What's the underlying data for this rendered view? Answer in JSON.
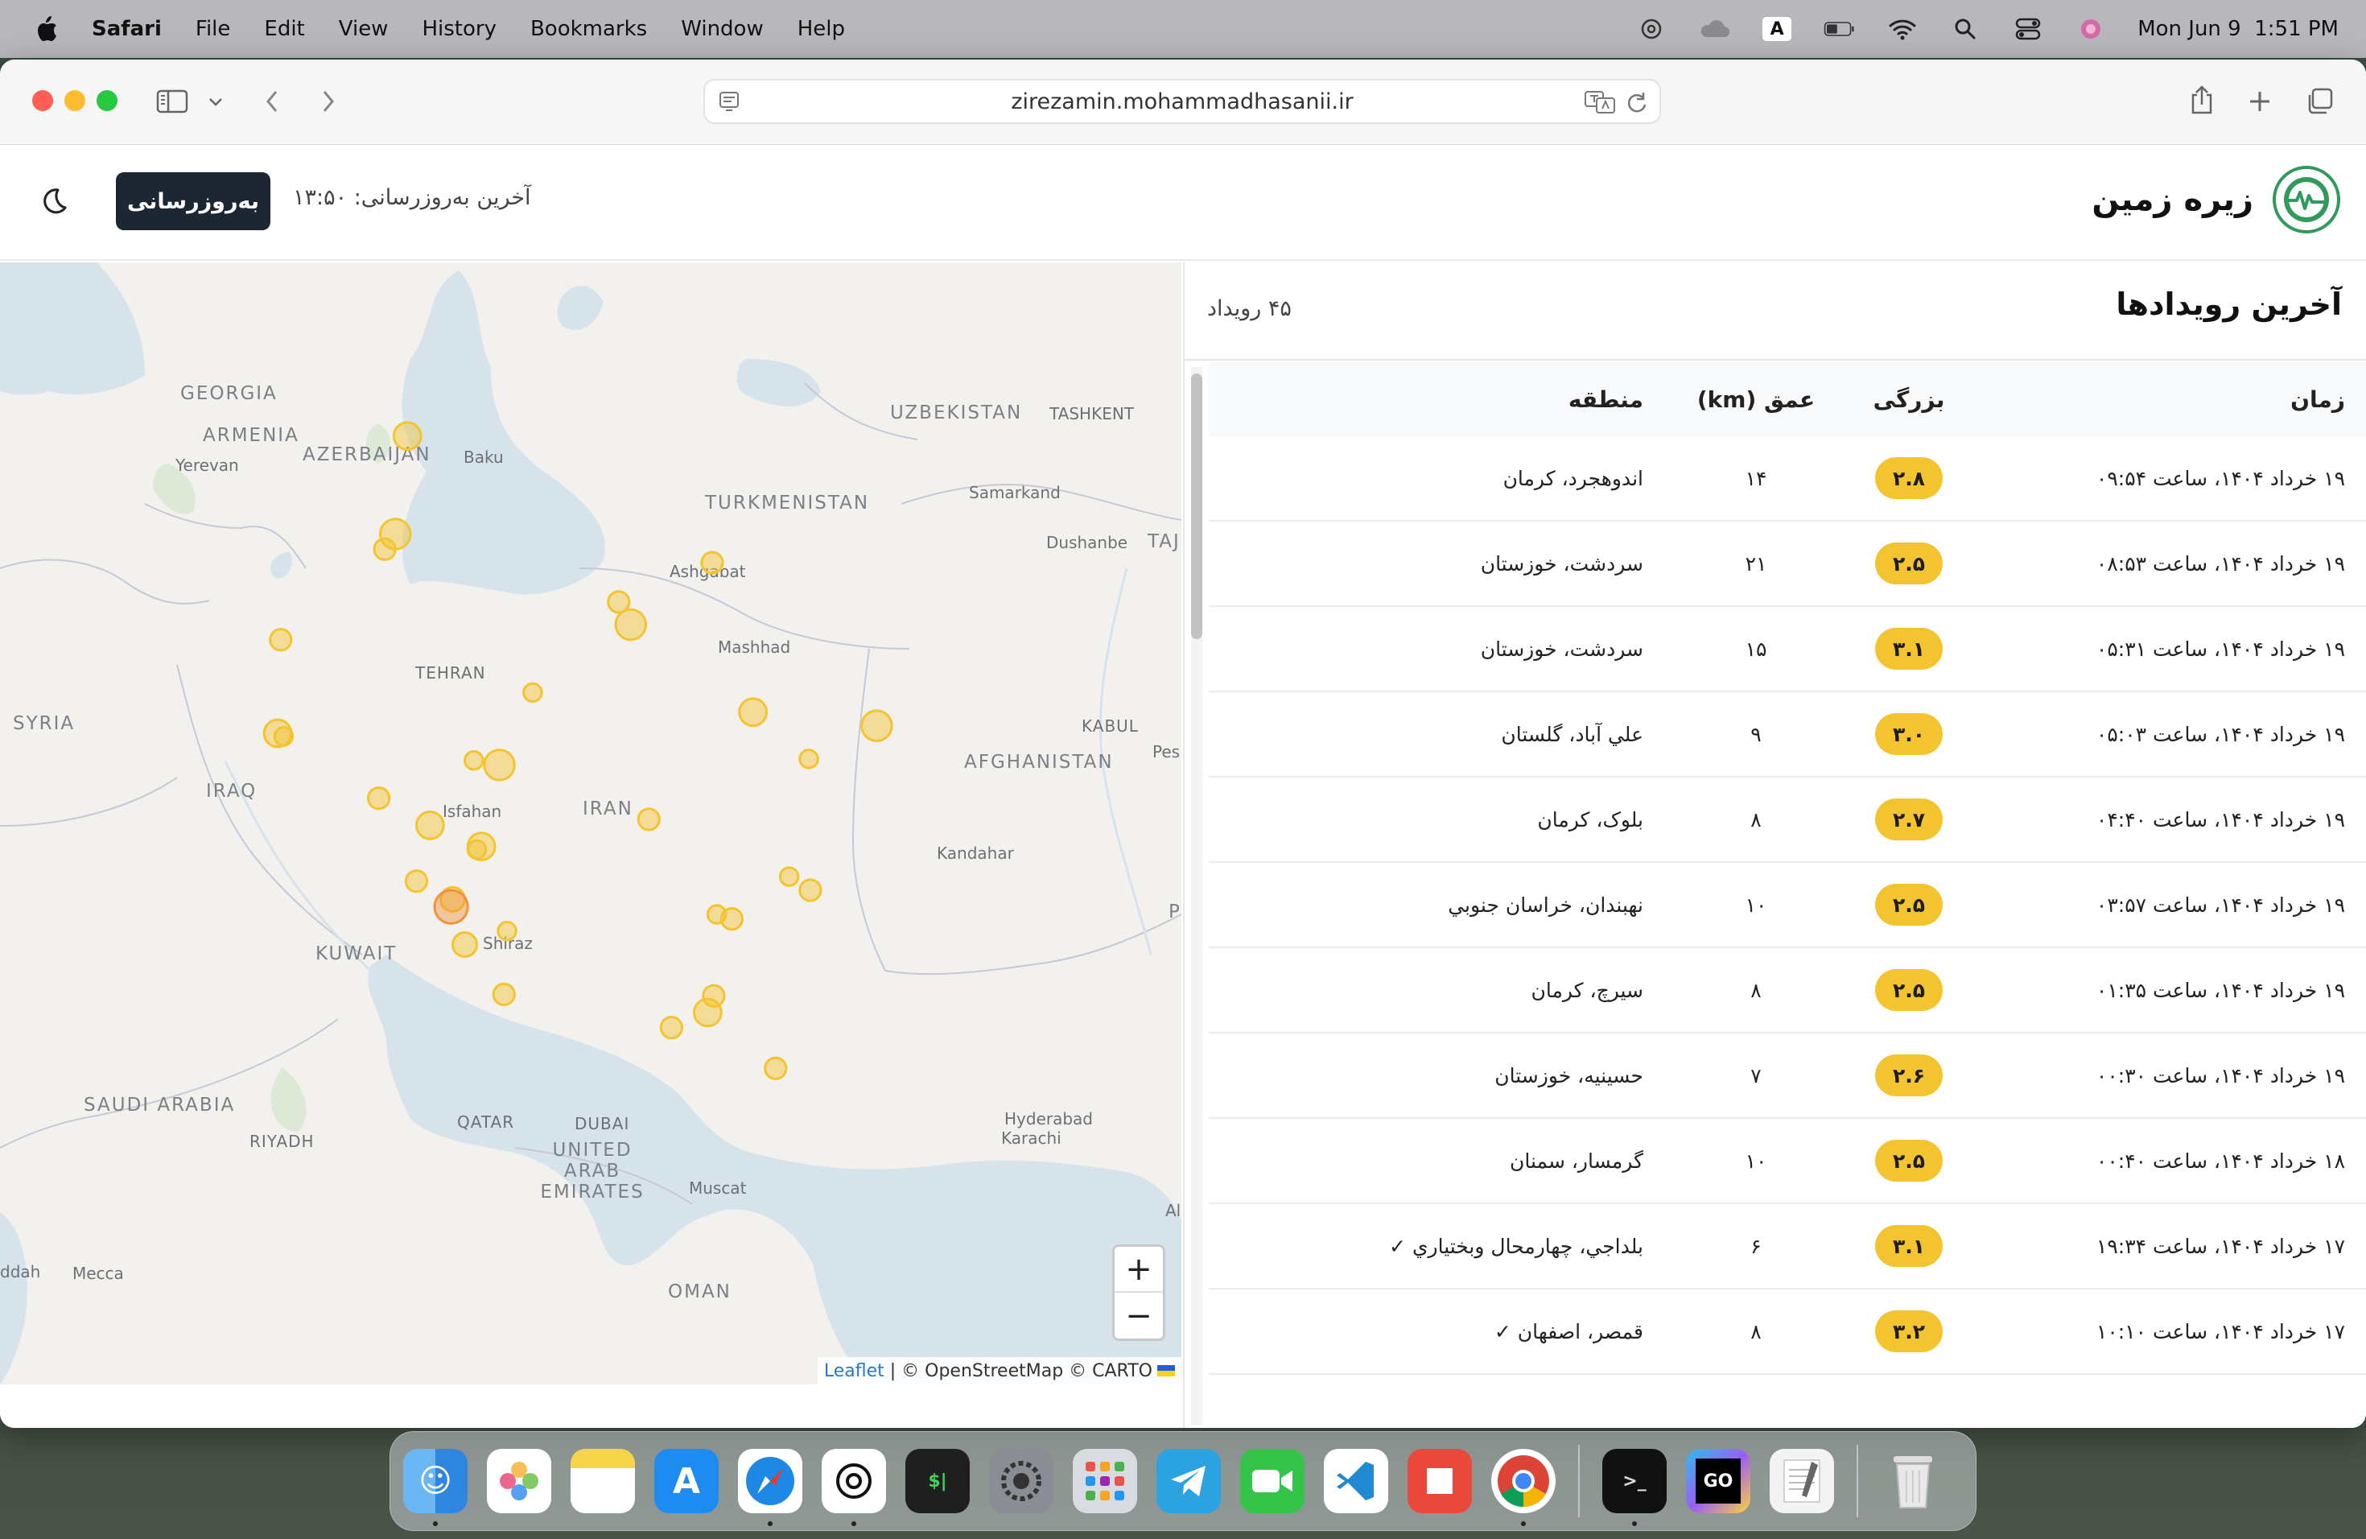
{
  "menubar": {
    "app": "Safari",
    "items": [
      "File",
      "Edit",
      "View",
      "History",
      "Bookmarks",
      "Window",
      "Help"
    ],
    "input_badge": "A",
    "datetime": "Mon Jun 9  1:51 PM"
  },
  "browser": {
    "url": "zirezamin.mohammadhasanii.ir"
  },
  "header": {
    "brand": "زیره زمین",
    "update_button": "به‌روزرسانی",
    "last_update": "آخرین به‌روزرسانی: ۱۳:۵۰"
  },
  "map": {
    "labels": {
      "georgia": "GEORGIA",
      "armenia": "ARMENIA",
      "azerbaijan": "AZERBAIJAN",
      "yerevan": "Yerevan",
      "baku": "Baku",
      "uzbekistan": "UZBEKISTAN",
      "tashkent": "TASHKENT",
      "turkmenistan": "TURKMENISTAN",
      "samarkand": "Samarkand",
      "dushanbe": "Dushanbe",
      "taj": "TAJ",
      "ashgabat": "Ashgabat",
      "syria": "SYRIA",
      "tehran": "TEHRAN",
      "mashhad": "Mashhad",
      "kabul": "KABUL",
      "pes": "Pes",
      "iraq": "IRAQ",
      "isfahan": "Isfahan",
      "iran": "IRAN",
      "afghanistan": "AFGHANISTAN",
      "kandahar": "Kandahar",
      "p": "P",
      "kuwait": "KUWAIT",
      "shiraz": "Shiraz",
      "saudi_arabia": "SAUDI ARABIA",
      "riyadh": "RIYADH",
      "qatar": "QATAR",
      "dubai": "DUBAI",
      "uae": "UNITED ARAB EMIRATES",
      "hyderabad": "Hyderabad",
      "karachi": "Karachi",
      "muscat": "Muscat",
      "oman": "OMAN",
      "ddah": "ddah",
      "mecca": "Mecca",
      "al": "Al"
    },
    "zoom_in": "+",
    "zoom_out": "−",
    "attribution_link": "Leaflet",
    "attribution_text": " | © OpenStreetMap © CARTO"
  },
  "events": {
    "title": "آخرین رویدادها",
    "count": "۴۵ رویداد",
    "columns": {
      "time": "زمان",
      "magnitude": "بزرگی",
      "depth": "عمق (km)",
      "region": "منطقه"
    },
    "rows": [
      {
        "time": "۱۹ خرداد ۱۴۰۴، ساعت ۰۹:۵۴",
        "magnitude": "۲.۸",
        "depth": "۱۴",
        "region": "اندوهجرد، کرمان"
      },
      {
        "time": "۱۹ خرداد ۱۴۰۴، ساعت ۰۸:۵۳",
        "magnitude": "۲.۵",
        "depth": "۲۱",
        "region": "سردشت، خوزستان"
      },
      {
        "time": "۱۹ خرداد ۱۴۰۴، ساعت ۰۵:۳۱",
        "magnitude": "۳.۱",
        "depth": "۱۵",
        "region": "سردشت، خوزستان"
      },
      {
        "time": "۱۹ خرداد ۱۴۰۴، ساعت ۰۵:۰۳",
        "magnitude": "۳.۰",
        "depth": "۹",
        "region": "علي آباد، گلستان"
      },
      {
        "time": "۱۹ خرداد ۱۴۰۴، ساعت ۰۴:۴۰",
        "magnitude": "۲.۷",
        "depth": "۸",
        "region": "بلوک، کرمان"
      },
      {
        "time": "۱۹ خرداد ۱۴۰۴، ساعت ۰۳:۵۷",
        "magnitude": "۲.۵",
        "depth": "۱۰",
        "region": "نهبندان، خراسان جنوبي"
      },
      {
        "time": "۱۹ خرداد ۱۴۰۴، ساعت ۰۱:۳۵",
        "magnitude": "۲.۵",
        "depth": "۸",
        "region": "سيرچ، کرمان"
      },
      {
        "time": "۱۹ خرداد ۱۴۰۴، ساعت ۰۰:۳۰",
        "magnitude": "۲.۶",
        "depth": "۷",
        "region": "حسينيه، خوزستان"
      },
      {
        "time": "۱۸ خرداد ۱۴۰۴، ساعت ۰۰:۴۰",
        "magnitude": "۲.۵",
        "depth": "۱۰",
        "region": "گرمسار، سمنان"
      },
      {
        "time": "۱۷ خرداد ۱۴۰۴، ساعت ۱۹:۳۴",
        "magnitude": "۳.۱",
        "depth": "۶",
        "region": "بلداجي، چهارمحال وبختياري ✓"
      },
      {
        "time": "۱۷ خرداد ۱۴۰۴، ساعت ۱۰:۱۰",
        "magnitude": "۳.۲",
        "depth": "۸",
        "region": "قمصر، اصفهان ✓"
      }
    ]
  },
  "colors": {
    "marker_fill": "#f4c430",
    "marker_highlight": "#f0923b",
    "button_bg": "#1d2733",
    "brand_green": "#2f9a5b"
  },
  "dock": {
    "apps": [
      "finder-icon",
      "photos-icon",
      "notes-icon",
      "app-store-icon",
      "safari-icon",
      "chatgpt-icon",
      "terminal-icon",
      "system-settings-icon",
      "launchpad-icon",
      "telegram-icon",
      "facetime-icon",
      "vscode-icon",
      "presentation-icon",
      "chrome-icon",
      "terminal-2-icon",
      "goland-icon",
      "textedit-icon",
      "trash-icon"
    ]
  }
}
